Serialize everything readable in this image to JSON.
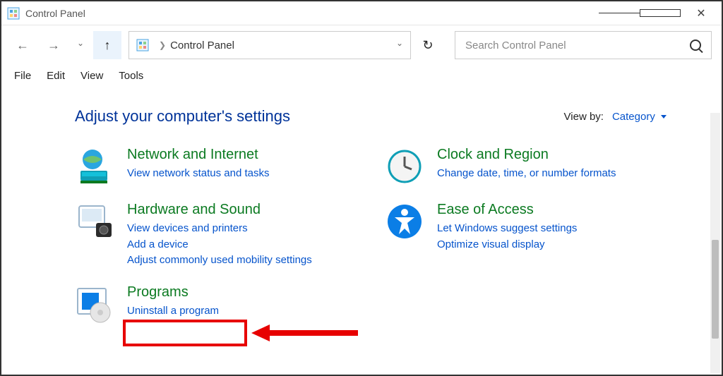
{
  "window": {
    "title": "Control Panel"
  },
  "address": {
    "crumb": "Control Panel"
  },
  "search": {
    "placeholder": "Search Control Panel"
  },
  "menu": {
    "file": "File",
    "edit": "Edit",
    "view": "View",
    "tools": "Tools"
  },
  "heading": "Adjust your computer's settings",
  "viewby": {
    "label": "View by:",
    "value": "Category"
  },
  "categories": {
    "network": {
      "title": "Network and Internet",
      "links": [
        "View network status and tasks"
      ]
    },
    "hardware": {
      "title": "Hardware and Sound",
      "links": [
        "View devices and printers",
        "Add a device",
        "Adjust commonly used mobility settings"
      ]
    },
    "programs": {
      "title": "Programs",
      "links": [
        "Uninstall a program"
      ]
    },
    "clock": {
      "title": "Clock and Region",
      "links": [
        "Change date, time, or number formats"
      ]
    },
    "ease": {
      "title": "Ease of Access",
      "links": [
        "Let Windows suggest settings",
        "Optimize visual display"
      ]
    }
  }
}
